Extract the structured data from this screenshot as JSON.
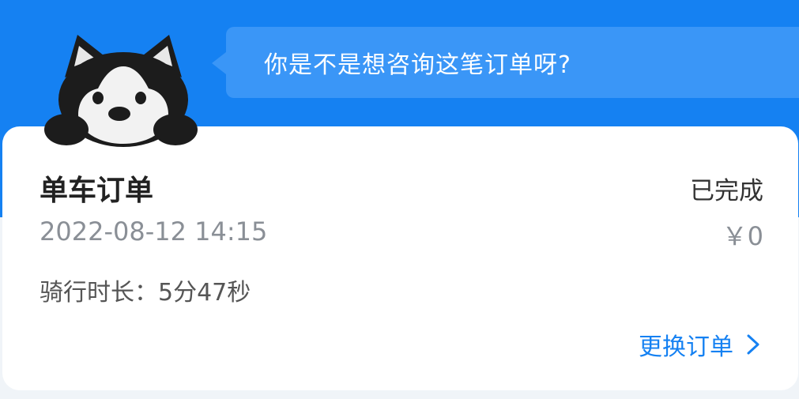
{
  "header": {
    "bubble_text": "你是不是想咨询这笔订单呀?"
  },
  "order": {
    "title": "单车订单",
    "status": "已完成",
    "datetime": "2022-08-12 14:15",
    "price": "￥0",
    "duration": "骑行时长：5分47秒",
    "change_label": "更换订单"
  },
  "icons": {
    "mascot": "husky-mascot-icon",
    "change": "chevron-right-icon"
  },
  "colors": {
    "header_blue": "#1581f2",
    "bubble_blue": "#3a96f7",
    "link_blue": "#1581f2"
  }
}
